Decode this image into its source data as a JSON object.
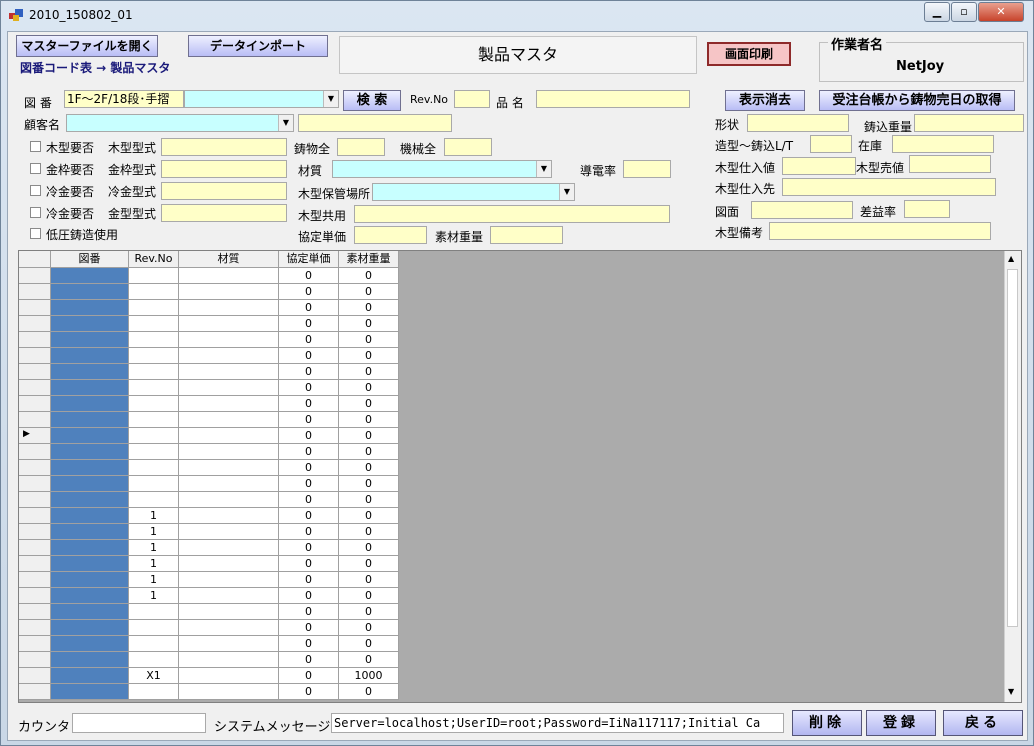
{
  "window": {
    "title": "2010_150802_01",
    "min": "▁",
    "max": "▫",
    "close": "✕"
  },
  "header": {
    "open_master_label": "マスターファイルを開く",
    "data_import_label": "データインポート",
    "breadcrumb": "図番コード表 → 製品マスタ",
    "screen_title": "製品マスタ",
    "print_label": "画面印刷",
    "operator_group": "作業者名",
    "operator_name": "NetJoy"
  },
  "search": {
    "zuban_label": "図 番",
    "zuban_value": "1F～2F/18段･手摺",
    "search_label": "検 索",
    "revno_label": "Rev.No",
    "hinmei_label": "品 名",
    "clear_label": "表示消去",
    "fetch_label": "受注台帳から鋳物完日の取得",
    "customer_label": "顧客名"
  },
  "checks": [
    {
      "label": "木型要否",
      "field": "木型型式"
    },
    {
      "label": "金枠要否",
      "field": "金枠型式"
    },
    {
      "label": "冷金要否",
      "field": "冷金型式"
    },
    {
      "label": "冷金要否",
      "field": "金型型式"
    },
    {
      "label": "低圧鋳造使用",
      "field": ""
    }
  ],
  "mid": {
    "chuubutsu_label": "鋳物全",
    "kikai_label": "機械全",
    "zaishitsu_label": "材質",
    "dendenritsu_label": "導電率",
    "hokan_label": "木型保管場所",
    "kyouyou_label": "木型共用",
    "kyoutei_label": "協定単価",
    "sozai_label": "素材重量"
  },
  "right": {
    "keijou_label": "形状",
    "ikomi_label": "鋳込重量",
    "lt_label": "造型～鋳込L/T",
    "zaiko_label": "在庫",
    "shiire_label": "木型仕入値",
    "baika_label": "木型売値",
    "shiiresaki_label": "木型仕入先",
    "zumen_label": "図面",
    "saeki_label": "差益率",
    "bikou_label": "木型備考"
  },
  "table": {
    "headers": [
      "図番",
      "Rev.No",
      "材質",
      "協定単価",
      "素材重量"
    ],
    "rows": [
      [
        "",
        "",
        "",
        "0",
        "0"
      ],
      [
        "",
        "",
        "",
        "0",
        "0"
      ],
      [
        "",
        "",
        "",
        "0",
        "0"
      ],
      [
        "",
        "",
        "",
        "0",
        "0"
      ],
      [
        "",
        "",
        "",
        "0",
        "0"
      ],
      [
        "",
        "",
        "",
        "0",
        "0"
      ],
      [
        "",
        "",
        "",
        "0",
        "0"
      ],
      [
        "",
        "",
        "",
        "0",
        "0"
      ],
      [
        "",
        "",
        "",
        "0",
        "0"
      ],
      [
        "",
        "",
        "",
        "0",
        "0"
      ],
      [
        "",
        "",
        "",
        "0",
        "0"
      ],
      [
        "",
        "",
        "",
        "0",
        "0"
      ],
      [
        "",
        "",
        "",
        "0",
        "0"
      ],
      [
        "",
        "",
        "",
        "0",
        "0"
      ],
      [
        "",
        "",
        "",
        "0",
        "0"
      ],
      [
        "",
        "1",
        "",
        "0",
        "0"
      ],
      [
        "",
        "1",
        "",
        "0",
        "0"
      ],
      [
        "",
        "1",
        "",
        "0",
        "0"
      ],
      [
        "",
        "1",
        "",
        "0",
        "0"
      ],
      [
        "",
        "1",
        "",
        "0",
        "0"
      ],
      [
        "",
        "1",
        "",
        "0",
        "0"
      ],
      [
        "",
        "",
        "",
        "0",
        "0"
      ],
      [
        "",
        "",
        "",
        "0",
        "0"
      ],
      [
        "",
        "",
        "",
        "0",
        "0"
      ],
      [
        "",
        "",
        "",
        "0",
        "0"
      ],
      [
        "",
        "X1",
        "",
        "0",
        "1000"
      ],
      [
        "",
        "",
        "",
        "0",
        "0"
      ]
    ],
    "current_row_marker": "▶"
  },
  "footer": {
    "counter_label": "カウンタ",
    "sysmsg_label": "システムメッセージ",
    "sysmsg_value": "Server=localhost;UserID=root;Password=IiNa117117;Initial Ca",
    "delete_label": "削除",
    "register_label": "登録",
    "back_label": "戻る"
  }
}
